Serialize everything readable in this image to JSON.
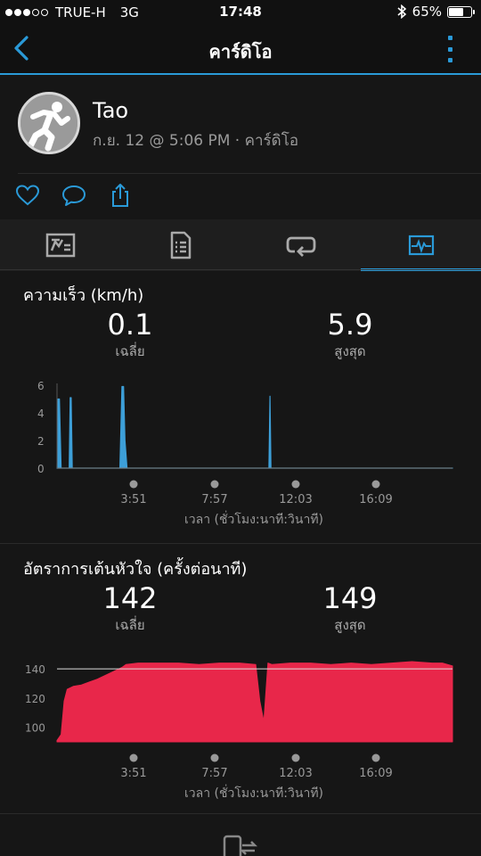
{
  "status_bar": {
    "carrier": "TRUE-H",
    "network": "3G",
    "time": "17:48",
    "battery": "65%",
    "battery_level": 0.65,
    "signal_bars_filled": 3
  },
  "nav": {
    "title": "คาร์ดิโอ"
  },
  "profile": {
    "name": "Tao",
    "subtitle": "ก.ย. 12 @ 5:06 PM · คาร์ดิโอ"
  },
  "actions": [
    "heart-icon",
    "comment-icon",
    "share-icon"
  ],
  "tabs": [
    {
      "icon": "summary-icon"
    },
    {
      "icon": "details-icon"
    },
    {
      "icon": "laps-icon"
    },
    {
      "icon": "charts-icon",
      "active": true
    }
  ],
  "colors": {
    "accent": "#2a9ad8",
    "speed": "#3d9fd8",
    "heart": "#e8274a"
  },
  "speed": {
    "title": "ความเร็ว (km/h)",
    "avg_value": "0.1",
    "avg_label": "เฉลี่ย",
    "max_value": "5.9",
    "max_label": "สูงสุด",
    "xlabel": "เวลา (ชั่วโมง:นาที:วินาที)"
  },
  "heart_rate": {
    "title": "อัตราการเต้นหัวใจ (ครั้งต่อนาที)",
    "avg_value": "142",
    "avg_label": "เฉลี่ย",
    "max_value": "149",
    "max_label": "สูงสุด",
    "xlabel": "เวลา (ชั่วโมง:นาที:วินาที)"
  },
  "chart_data": [
    {
      "type": "area",
      "ylabel": "",
      "xlabel": "เวลา (ชั่วโมง:นาที:วินาที)",
      "x_ticks": [
        "3:51",
        "7:57",
        "12:03",
        "16:09"
      ],
      "y_ticks": [
        0,
        2,
        4,
        6
      ],
      "ylim": [
        0,
        6
      ],
      "xlim_minutes": [
        0,
        19.5
      ],
      "x_minutes": [
        0,
        0.05,
        0.12,
        0.2,
        0.6,
        0.65,
        0.7,
        0.75,
        3.1,
        3.2,
        3.28,
        3.35,
        3.45,
        10.45,
        10.5,
        10.55,
        19.5
      ],
      "values": [
        0,
        5.0,
        5.0,
        0,
        0,
        5.1,
        5.1,
        0,
        0,
        5.9,
        5.9,
        2.0,
        0,
        0,
        5.2,
        0,
        0
      ],
      "grid": false
    },
    {
      "type": "area",
      "ylabel": "",
      "xlabel": "เวลา (ชั่วโมง:นาที:วินาที)",
      "x_ticks": [
        "3:51",
        "7:57",
        "12:03",
        "16:09"
      ],
      "y_ticks": [
        100,
        120,
        140
      ],
      "ylim": [
        90,
        145
      ],
      "reference_line": 140,
      "xlim_minutes": [
        0,
        19.5
      ],
      "x_minutes": [
        0,
        0.2,
        0.35,
        0.5,
        0.8,
        1.2,
        1.6,
        2.0,
        2.6,
        3.2,
        3.4,
        4.0,
        5.0,
        6.0,
        7.0,
        8.0,
        9.0,
        9.8,
        10.0,
        10.2,
        10.4,
        10.6,
        11.5,
        12.5,
        13.5,
        14.5,
        15.5,
        16.5,
        17.5,
        18.5,
        19.0,
        19.5
      ],
      "values": [
        91,
        95,
        118,
        126,
        128,
        129,
        131,
        133,
        137,
        141,
        143,
        144,
        144,
        144,
        143,
        144,
        144,
        143,
        118,
        104,
        144,
        143,
        144,
        144,
        143,
        144,
        143,
        144,
        145,
        144,
        144,
        142
      ],
      "grid": false
    }
  ]
}
